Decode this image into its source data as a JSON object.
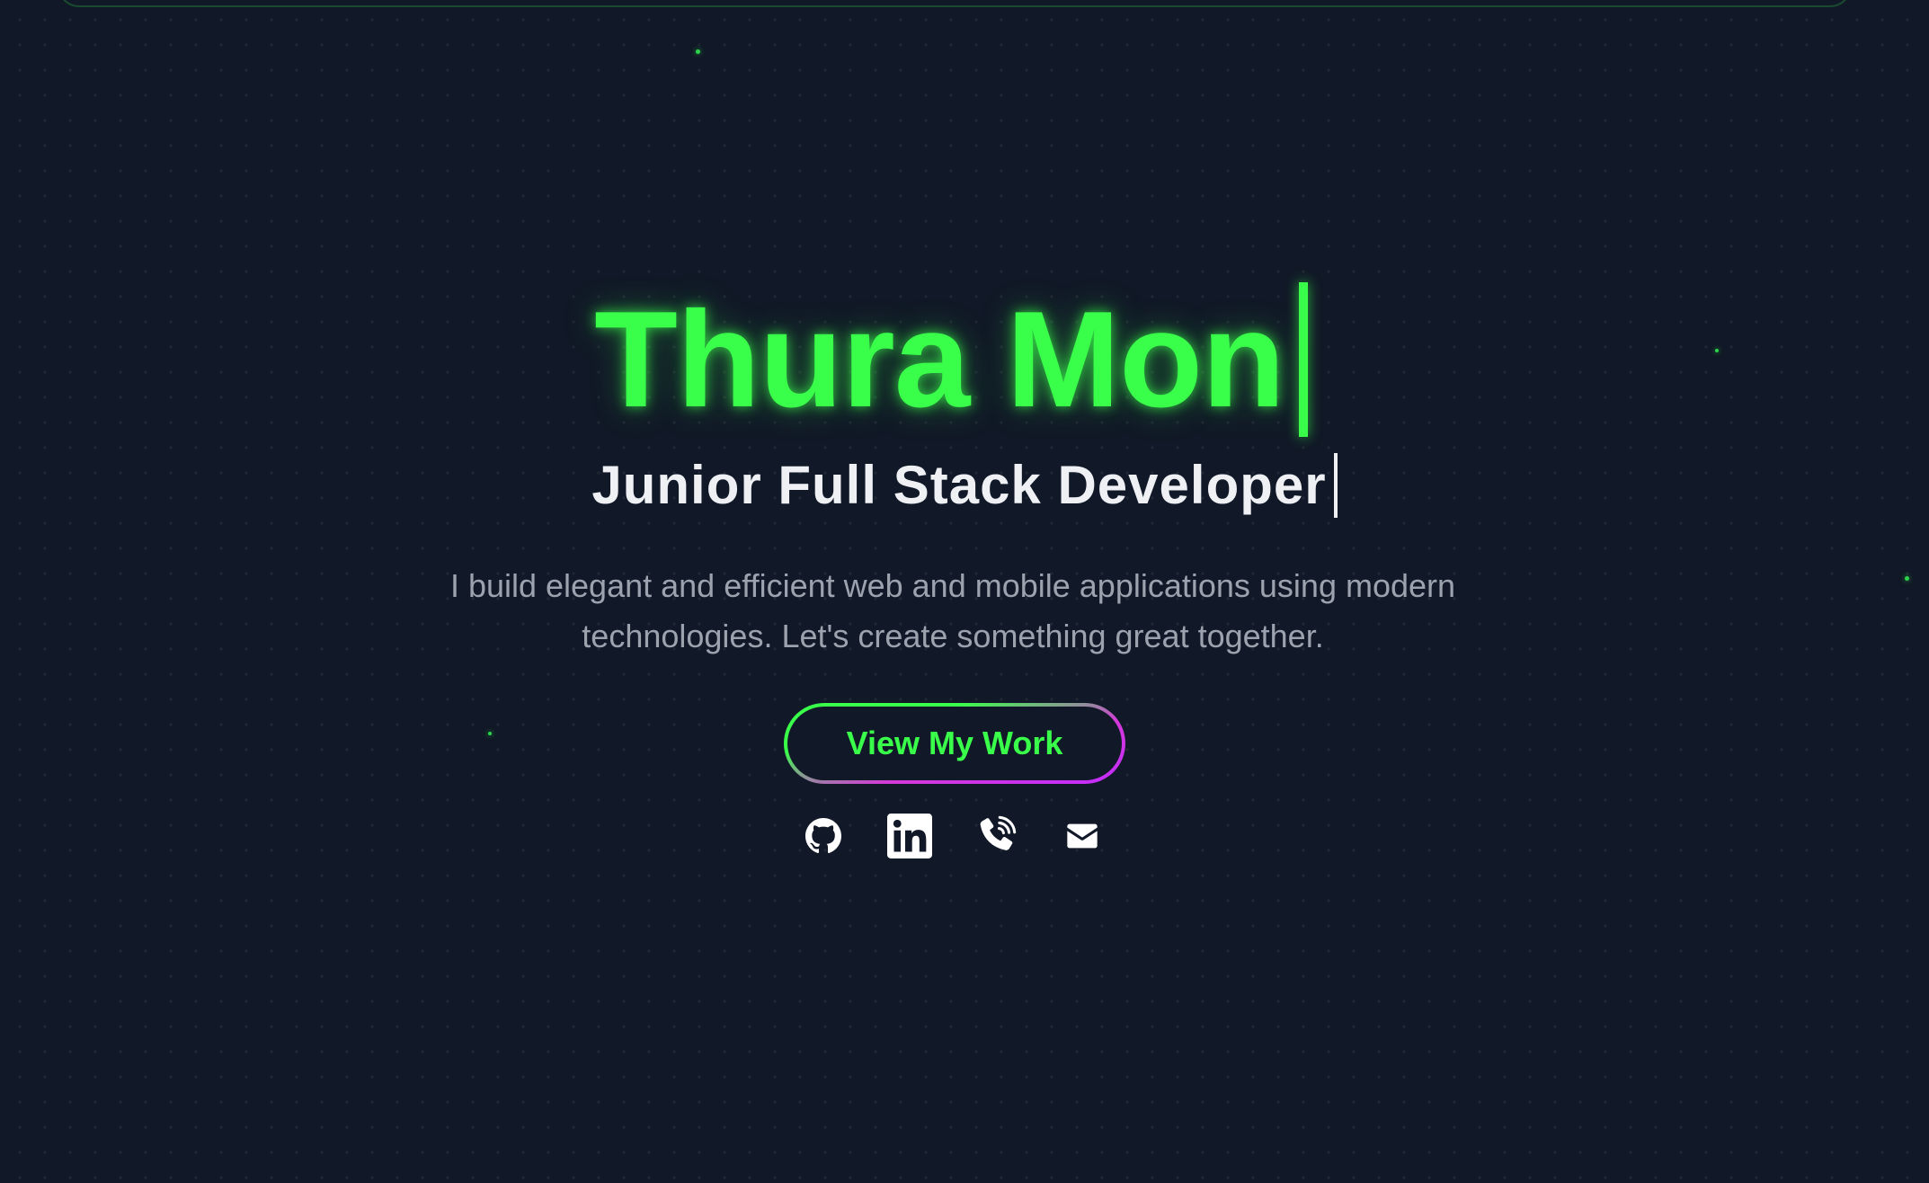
{
  "hero": {
    "name": "Thura Mon",
    "role": "Junior Full Stack Developer",
    "tagline_line1": "I build elegant and efficient web and mobile applications using modern",
    "tagline_line2": "technologies. Let's create something great together.",
    "cta_label": "View My Work"
  },
  "socials": [
    {
      "icon": "github-icon"
    },
    {
      "icon": "linkedin-icon"
    },
    {
      "icon": "phone-icon"
    },
    {
      "icon": "email-icon"
    }
  ],
  "colors": {
    "background": "#111827",
    "accent_green": "#39ff4a",
    "accent_magenta": "#c42bff",
    "text_primary": "#eef0f4",
    "text_muted": "#9ca3af"
  }
}
